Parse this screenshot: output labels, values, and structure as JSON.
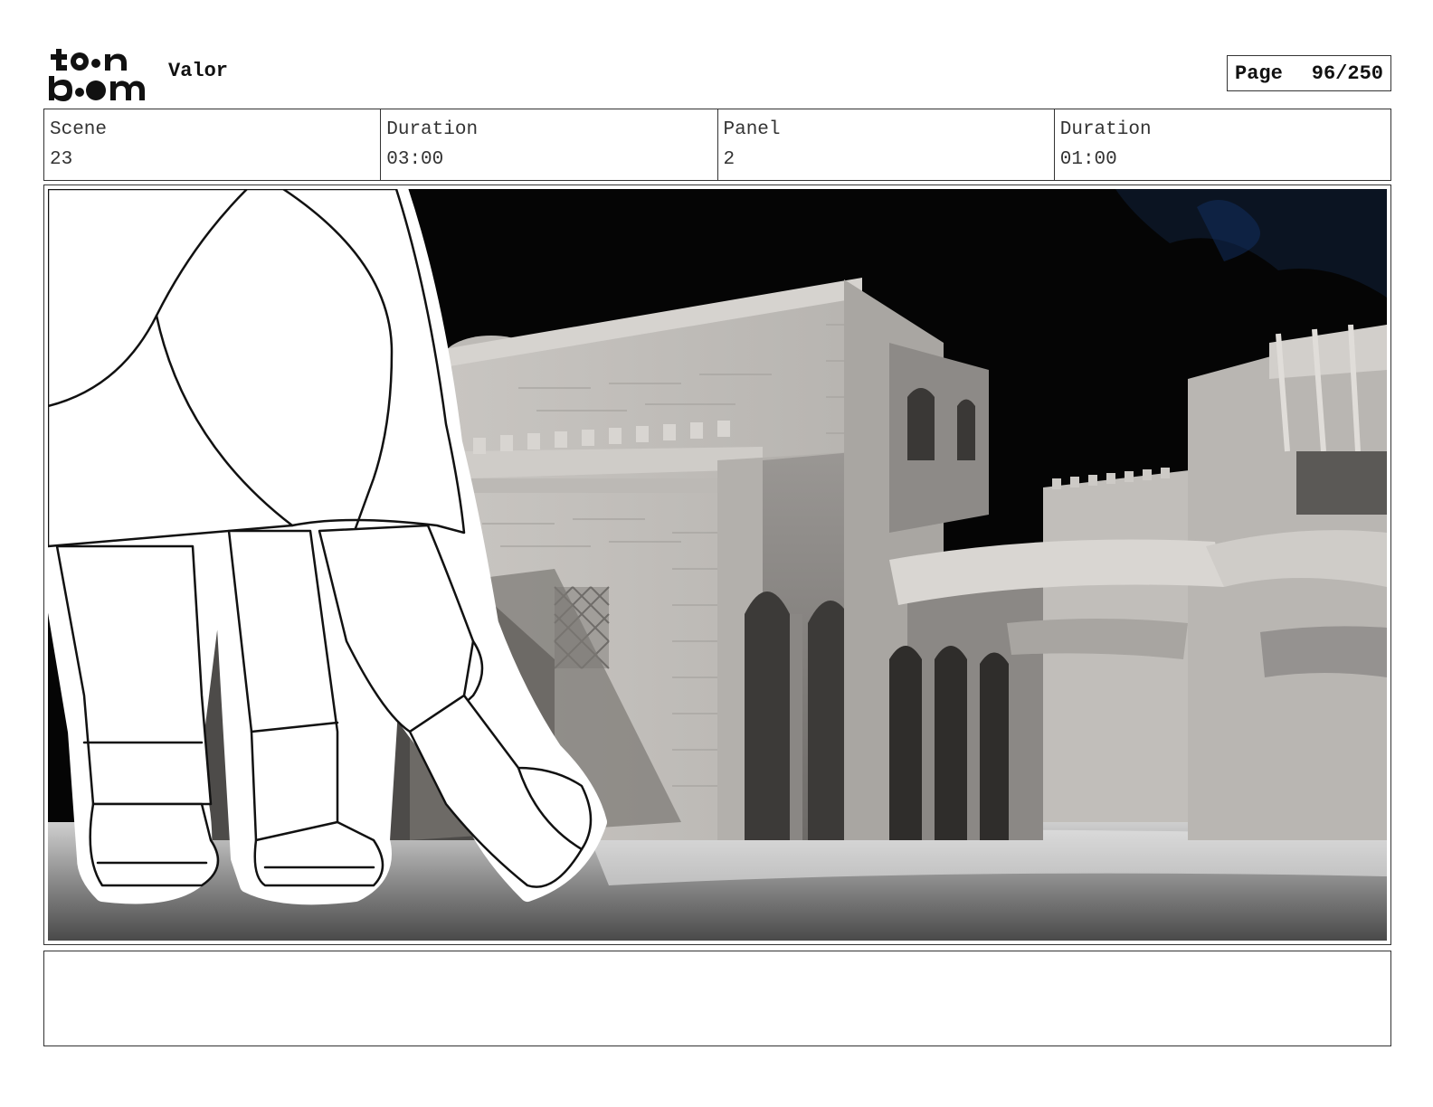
{
  "header": {
    "logo_text": "toon boom",
    "project_title": "Valor",
    "page_label": "Page",
    "page_number": "96/250"
  },
  "info": [
    {
      "label": "Scene",
      "value": "23"
    },
    {
      "label": "Duration",
      "value": "03:00"
    },
    {
      "label": "Panel",
      "value": "2"
    },
    {
      "label": "Duration",
      "value": "01:00"
    }
  ],
  "caption": {
    "text": ""
  }
}
